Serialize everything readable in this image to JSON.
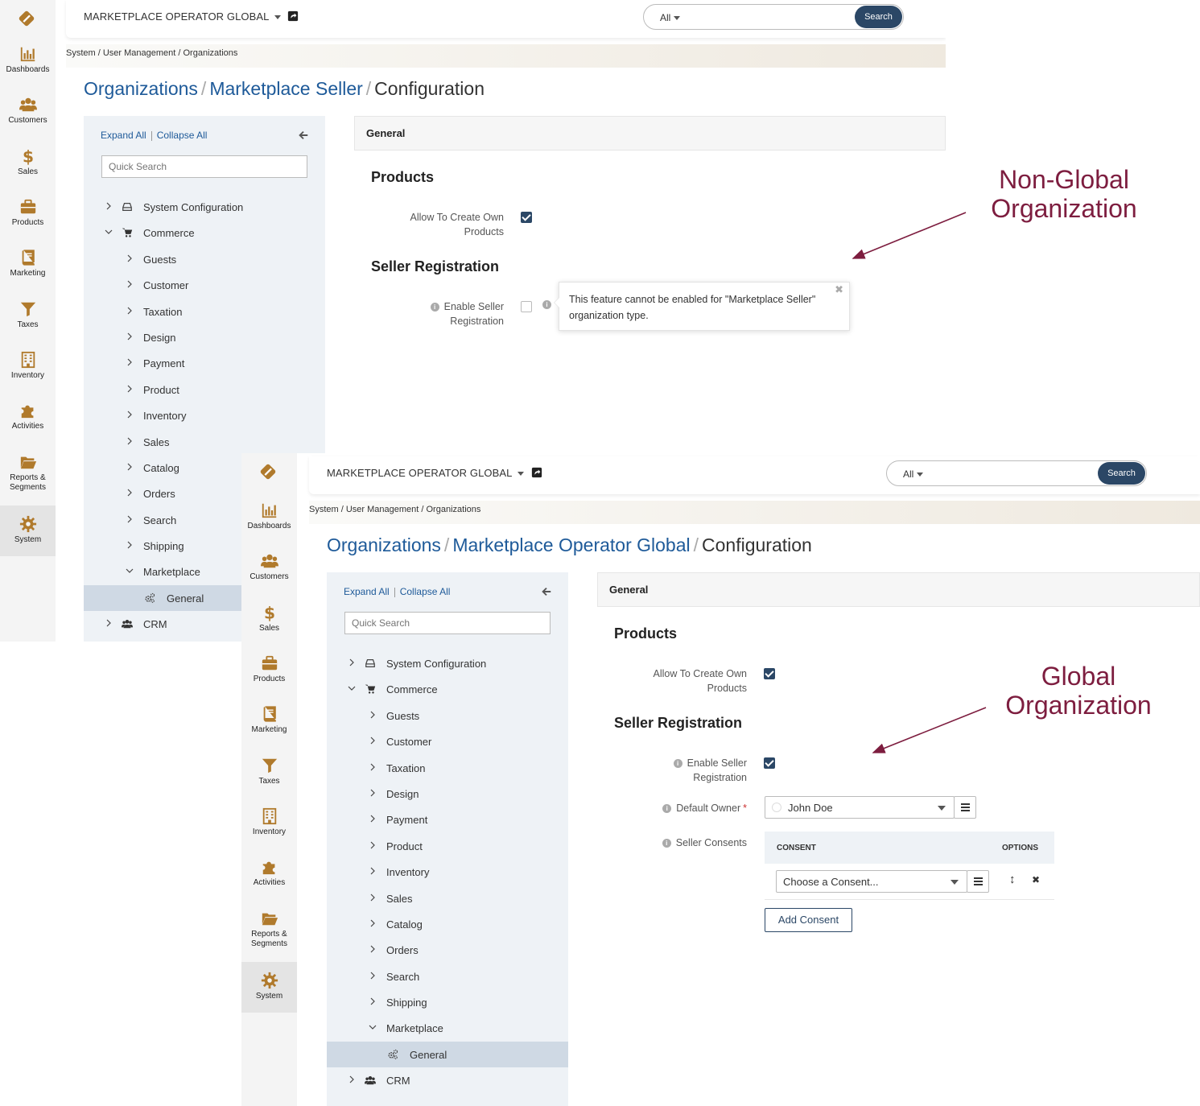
{
  "rail": {
    "items": [
      {
        "label": "Dashboards",
        "icon": "bar-chart-icon"
      },
      {
        "label": "Customers",
        "icon": "users-icon"
      },
      {
        "label": "Sales",
        "icon": "dollar-icon"
      },
      {
        "label": "Products",
        "icon": "briefcase-icon"
      },
      {
        "label": "Marketing",
        "icon": "book-icon"
      },
      {
        "label": "Taxes",
        "icon": "filter-icon"
      },
      {
        "label": "Inventory",
        "icon": "building-icon"
      },
      {
        "label": "Activities",
        "icon": "puzzle-icon"
      },
      {
        "label": "Reports & Segments",
        "icon": "folder-icon"
      },
      {
        "label": "System",
        "icon": "gear-icon"
      }
    ]
  },
  "topbar": {
    "org": "MARKETPLACE OPERATOR GLOBAL",
    "scope": "All",
    "search_btn": "Search"
  },
  "breadcrumb": "System / User Management / Organizations",
  "title": {
    "part1": "Organizations",
    "sep": "/",
    "part3": "Configuration"
  },
  "top_title_org": "Marketplace Seller",
  "bottom_title_org": "Marketplace Operator Global",
  "sidebar": {
    "expand_all": "Expand All",
    "collapse_all": "Collapse All",
    "quick_search_placeholder": "Quick Search",
    "tree": [
      {
        "label": "System Configuration",
        "level": 0,
        "chevron": "right",
        "icon": "drive-icon"
      },
      {
        "label": "Commerce",
        "level": 0,
        "chevron": "down",
        "icon": "cart-icon"
      },
      {
        "label": "Guests",
        "level": 1,
        "chevron": "right"
      },
      {
        "label": "Customer",
        "level": 1,
        "chevron": "right"
      },
      {
        "label": "Taxation",
        "level": 1,
        "chevron": "right"
      },
      {
        "label": "Design",
        "level": 1,
        "chevron": "right"
      },
      {
        "label": "Payment",
        "level": 1,
        "chevron": "right"
      },
      {
        "label": "Product",
        "level": 1,
        "chevron": "right"
      },
      {
        "label": "Inventory",
        "level": 1,
        "chevron": "right"
      },
      {
        "label": "Sales",
        "level": 1,
        "chevron": "right"
      },
      {
        "label": "Catalog",
        "level": 1,
        "chevron": "right"
      },
      {
        "label": "Orders",
        "level": 1,
        "chevron": "right"
      },
      {
        "label": "Search",
        "level": 1,
        "chevron": "right"
      },
      {
        "label": "Shipping",
        "level": 1,
        "chevron": "right"
      },
      {
        "label": "Marketplace",
        "level": 1,
        "chevron": "down"
      },
      {
        "label": "General",
        "level": 2,
        "chevron": "none",
        "icon": "gears-icon",
        "selected": true
      },
      {
        "label": "CRM",
        "level": 0,
        "chevron": "right",
        "icon": "users-icon"
      }
    ]
  },
  "content": {
    "section_header": "General",
    "products_title": "Products",
    "allow_label_1": "Allow To Create Own",
    "allow_label_2": "Products",
    "seller_reg_title": "Seller Registration",
    "enable_label_1": "Enable Seller",
    "enable_label_2": "Registration",
    "tooltip": "This feature cannot be enabled for \"Marketplace Seller\" organization type.",
    "default_owner_label": "Default Owner",
    "default_owner_value": "John Doe",
    "seller_consents_label": "Seller Consents",
    "consent_col": "CONSENT",
    "options_col": "OPTIONS",
    "consent_placeholder": "Choose a Consent...",
    "add_consent": "Add Consent"
  },
  "top_state": {
    "allow_create_products": true,
    "enable_seller_registration": false
  },
  "bottom_state": {
    "allow_create_products": true,
    "enable_seller_registration": true
  },
  "annotations": {
    "top_1": "Non-Global",
    "top_2": "Organization",
    "bottom_1": "Global",
    "bottom_2": "Organization",
    "color": "#7d1d3f"
  },
  "colors": {
    "brand": "#b07a2c",
    "link": "#1e5a99",
    "button": "#2b4766"
  }
}
